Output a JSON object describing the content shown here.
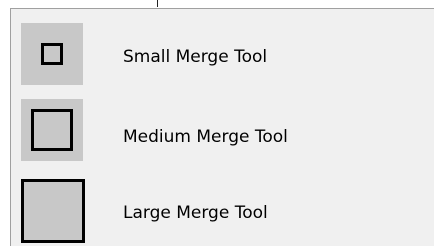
{
  "menu": {
    "items": [
      {
        "label": "Small Merge Tool",
        "icon": "small-square-icon"
      },
      {
        "label": "Medium Merge Tool",
        "icon": "medium-square-icon"
      },
      {
        "label": "Large Merge Tool",
        "icon": "large-square-icon"
      }
    ]
  },
  "colors": {
    "menu_background": "#f0f0f0",
    "icon_background": "#c8c8c8",
    "icon_border": "#000000",
    "menu_border": "#a0a0a0"
  }
}
